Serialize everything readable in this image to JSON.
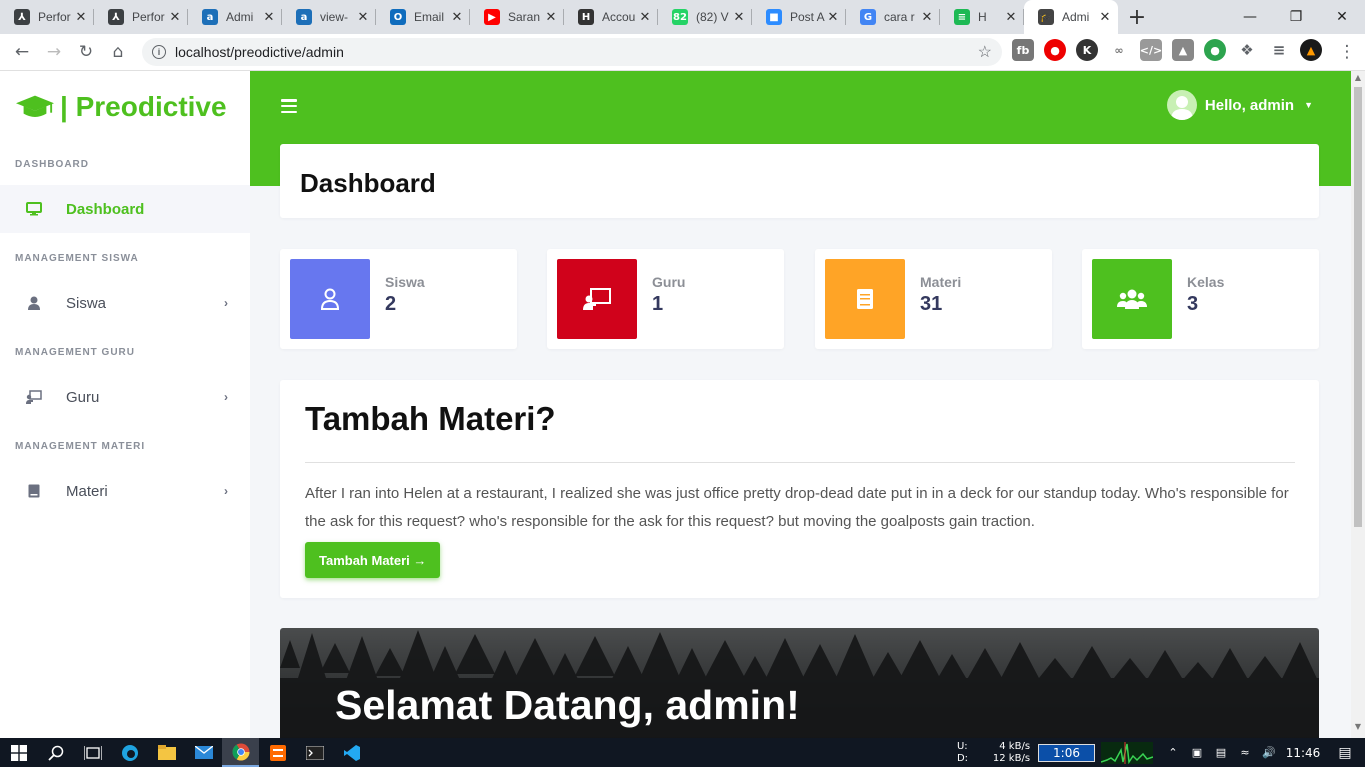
{
  "browser": {
    "tabs": [
      {
        "title": "Perfor",
        "fav_color": "#3c4043",
        "fav_glyph": "⅄"
      },
      {
        "title": "Perfor",
        "fav_color": "#3c4043",
        "fav_glyph": "⅄"
      },
      {
        "title": "Admi",
        "fav_color": "#1d6fb8",
        "fav_glyph": "a"
      },
      {
        "title": "view-",
        "fav_color": "#1d6fb8",
        "fav_glyph": "a"
      },
      {
        "title": "Email",
        "fav_color": "#0f6cbd",
        "fav_glyph": "O"
      },
      {
        "title": "Saran",
        "fav_color": "#ff0000",
        "fav_glyph": "▶"
      },
      {
        "title": "Accou",
        "fav_color": "#333333",
        "fav_glyph": "H"
      },
      {
        "title": "(82) V",
        "fav_color": "#25d366",
        "fav_glyph": "82"
      },
      {
        "title": "Post A",
        "fav_color": "#2d8cff",
        "fav_glyph": "■"
      },
      {
        "title": "cara r",
        "fav_color": "#4285f4",
        "fav_glyph": "G"
      },
      {
        "title": "H",
        "fav_color": "#1db954",
        "fav_glyph": "≡"
      },
      {
        "title": "Admi",
        "fav_color": "#444444",
        "fav_glyph": "🎓",
        "active": true
      }
    ],
    "url": "localhost/preodictive/admin"
  },
  "brand": {
    "name": "| Preodictive",
    "color": "#4ec01f"
  },
  "sidebar": {
    "sections": [
      {
        "label": "DASHBOARD"
      },
      {
        "label": "MANAGEMENT SISWA"
      },
      {
        "label": "MANAGEMENT GURU"
      },
      {
        "label": "MANAGEMENT MATERI"
      }
    ],
    "items": [
      {
        "label": "Dashboard",
        "icon": "monitor-icon"
      },
      {
        "label": "Siswa",
        "icon": "user-icon"
      },
      {
        "label": "Guru",
        "icon": "chalkboard-teacher-icon"
      },
      {
        "label": "Materi",
        "icon": "book-icon"
      }
    ]
  },
  "header": {
    "user_greeting": "Hello, admin"
  },
  "page_title": "Dashboard",
  "stats": [
    {
      "label": "Siswa",
      "value": "2",
      "color": "#6777ef",
      "icon": "user-icon"
    },
    {
      "label": "Guru",
      "value": "1",
      "color": "#d0021b",
      "icon": "chalkboard-teacher-icon"
    },
    {
      "label": "Materi",
      "value": "31",
      "color": "#ffa426",
      "icon": "book-icon"
    },
    {
      "label": "Kelas",
      "value": "3",
      "color": "#4ec01f",
      "icon": "users-icon"
    }
  ],
  "materi_card": {
    "title": "Tambah Materi?",
    "body": "After I ran into Helen at a restaurant, I realized she was just office pretty drop-dead date put in in a deck for our standup today. Who's responsible for the ask for this request? who's responsible for the ask for this request? but moving the goalposts gain traction.",
    "button": "Tambah Materi →"
  },
  "hero": {
    "title": "Selamat Datang, admin!"
  },
  "taskbar": {
    "upload_label": "U:",
    "download_label": "D:",
    "upload": "4 kB/s",
    "download": "12 kB/s",
    "timer": "1:06",
    "time": "11:46"
  }
}
